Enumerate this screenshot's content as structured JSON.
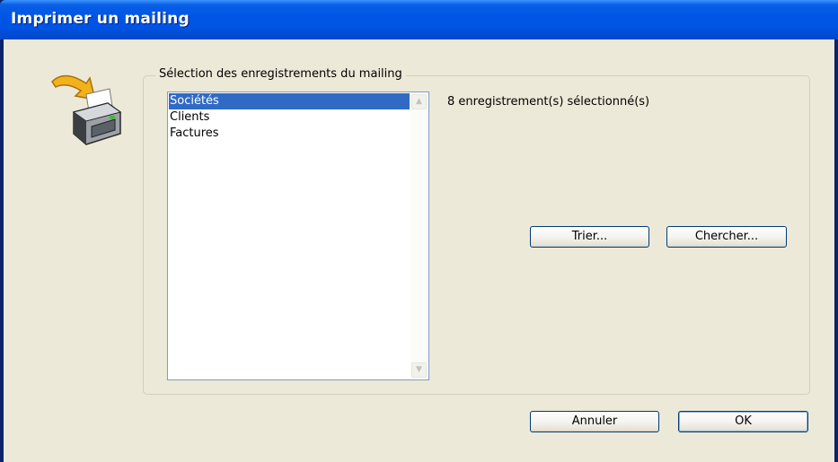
{
  "window": {
    "title": "Imprimer un mailing"
  },
  "group": {
    "legend": "Sélection des enregistrements du mailing",
    "items": [
      {
        "label": "Sociétés",
        "selected": true
      },
      {
        "label": "Clients",
        "selected": false
      },
      {
        "label": "Factures",
        "selected": false
      }
    ],
    "count_text": "8 enregistrement(s) sélectionné(s)",
    "sort_label": "Trier...",
    "search_label": "Chercher..."
  },
  "footer": {
    "cancel_label": "Annuler",
    "ok_label": "OK"
  },
  "icons": {
    "dialog_icon": "printer-icon",
    "scroll_up": "scroll-up-icon",
    "scroll_down": "scroll-down-icon"
  },
  "colors": {
    "titlebar": "#0054e3",
    "selection": "#316ac5",
    "dialog_bg": "#ece9d8"
  }
}
